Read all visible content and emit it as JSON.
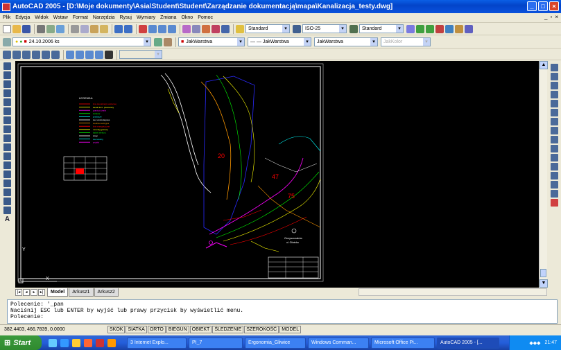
{
  "window": {
    "title": "AutoCAD 2005 - [D:\\Moje dokumenty\\Asia\\Student\\Student\\Zarządzanie dokumentacją\\mapa\\Kanalizacja_testy.dwg]",
    "btn_min": "_",
    "btn_max": "□",
    "btn_close": "×"
  },
  "menu": [
    "Plik",
    "Edycja",
    "Widok",
    "Wstaw",
    "Format",
    "Narzędzia",
    "Rysuj",
    "Wymiary",
    "Zmiana",
    "Okno",
    "Pomoc"
  ],
  "doc_btns": [
    "_",
    "▫",
    "×"
  ],
  "styles": {
    "text_style": "Standard",
    "dim_style": "ISO-25",
    "table_style": "Standard"
  },
  "layers": {
    "current": "24.10.2006 ks",
    "color": "JakWarstwa",
    "linetype": "— — JakWarstwa",
    "lineweight": "JakWarstwa",
    "plotstyle": "JakKolor"
  },
  "drawing": {
    "legend_title": "LEGENDA:",
    "legend_items": [
      "linie kanalizacji sanitarnej",
      "kanal tlocz. planowany",
      "granica dzialki",
      "kolektor",
      "przylacze",
      "siec wodociagowa",
      "studnia rewizyjna",
      "linie energetyczne",
      "rurociag gazowy",
      "kabel telekom.",
      "drogi",
      "ciek wodny",
      "projekt"
    ],
    "area_labels": [
      "20",
      "47",
      "75"
    ],
    "place_label": "Oczyszczalnia",
    "place_sub": "ul. Gliwicka",
    "axis_y": "Y",
    "axis_x": "X"
  },
  "layout_tabs": [
    "Model",
    "Arkusz1",
    "Arkusz2"
  ],
  "nav_buttons": [
    "|◂",
    "◂",
    "▸",
    "▸|"
  ],
  "command": {
    "line1": "Polecenie: '_pan",
    "line2": "Naciśnij ESC lub ENTER by wyjść lub prawy przycisk by wyświetlić menu.",
    "prompt": "Polecenie:"
  },
  "status": {
    "coords": "382.4403, 466.7839, 0.0000",
    "toggles": [
      "SKOK",
      "SIATKA",
      "ORTO",
      "BIEGUN",
      "OBIEKT",
      "ŚLEDZENIE",
      "SZEROKOŚĆ",
      "MODEL"
    ]
  },
  "taskbar": {
    "start": "Start",
    "items": [
      "3 Internet Explo...",
      "PI_7",
      "Ergonomia_Gliwice",
      "Windows Comman...",
      "Microsoft Office Pi...",
      "AutoCAD 2005 - [..."
    ],
    "clock": "21:47"
  }
}
